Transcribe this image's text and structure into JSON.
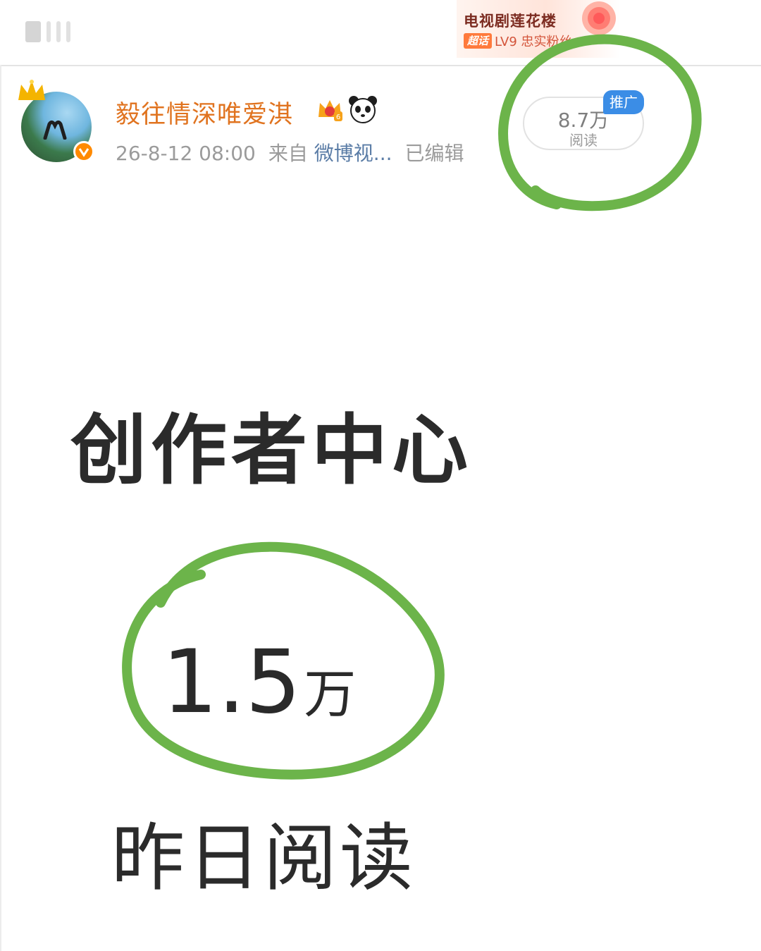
{
  "top_bar": {
    "topic_title": "电视剧莲花楼",
    "topic_badge": "超话",
    "topic_level": "LV9 忠实粉丝"
  },
  "post": {
    "username": "毅往情深唯爱淇",
    "timestamp": "26-8-12 08:00",
    "source_prefix": "来自",
    "source": "微博视...",
    "edited": "已编辑",
    "read_count": "8.7万",
    "read_label": "阅读",
    "promo_badge": "推广"
  },
  "creator_center": {
    "title": "创作者中心",
    "yesterday_reads_value": "1.5",
    "yesterday_reads_unit": "万",
    "yesterday_reads_label": "昨日阅读"
  },
  "colors": {
    "username": "#e0731f",
    "source_link": "#5a7ca6",
    "promo_badge": "#3b8de6",
    "annotation": "#6cb44a"
  }
}
